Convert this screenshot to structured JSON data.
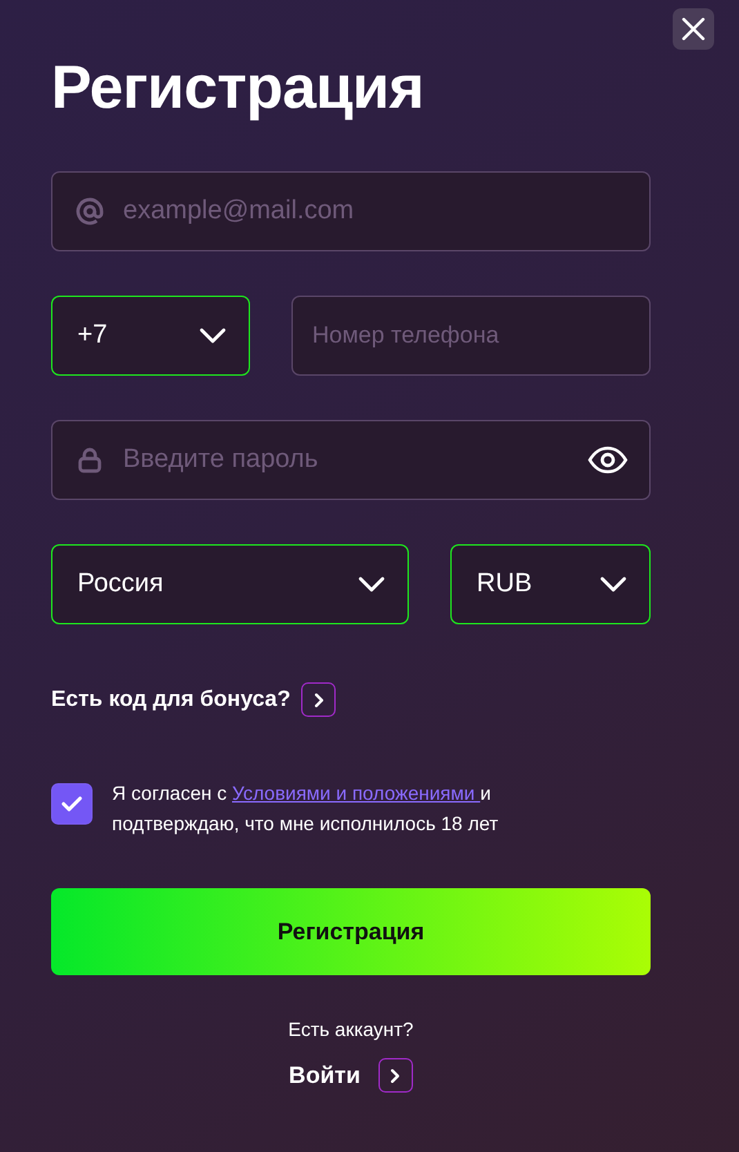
{
  "title": "Регистрация",
  "email": {
    "placeholder": "example@mail.com"
  },
  "phone_code": {
    "value": "+7",
    "valid": true
  },
  "phone": {
    "placeholder": "Номер телефона"
  },
  "password": {
    "placeholder": "Введите пароль"
  },
  "country": {
    "value": "Россия",
    "valid": true
  },
  "currency": {
    "value": "RUB",
    "valid": true
  },
  "bonus_link": "Есть код для бонуса?",
  "consent": {
    "checked": true,
    "before": "Я согласен с ",
    "link": "Условиями и положениями ",
    "after": "и подтверждаю, что мне исполнилось 18 лет"
  },
  "submit": "Регистрация",
  "login_prompt": "Есть аккаунт?",
  "login_link": "Войти"
}
